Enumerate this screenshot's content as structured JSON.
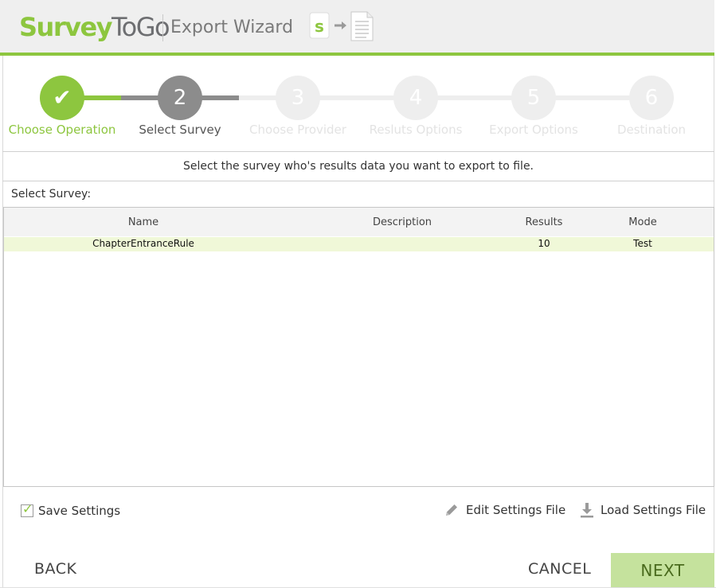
{
  "header": {
    "logo_part1": "Survey",
    "logo_part2": "ToGo",
    "title": "Export Wizard",
    "icon": "export-to-file-icon",
    "accent_color": "#8dc63f"
  },
  "steps": [
    {
      "number": "✔",
      "label": "Choose Operation",
      "state": "completed"
    },
    {
      "number": "2",
      "label": "Select Survey",
      "state": "current"
    },
    {
      "number": "3",
      "label": "Choose Provider",
      "state": "pending"
    },
    {
      "number": "4",
      "label": "Resluts Options",
      "state": "pending"
    },
    {
      "number": "5",
      "label": "Export Options",
      "state": "pending"
    },
    {
      "number": "6",
      "label": "Destination",
      "state": "pending"
    }
  ],
  "instruction": "Select the survey who's results data you want to export to file.",
  "select_label": "Select Survey:",
  "table": {
    "columns": [
      "Name",
      "Description",
      "Results",
      "Mode"
    ],
    "rows": [
      {
        "name": "ChapterEntranceRule",
        "description": "",
        "results": "10",
        "mode": "Test"
      }
    ]
  },
  "footer": {
    "save_settings_label": "Save Settings",
    "save_settings_checked": true,
    "edit_settings_label": "Edit Settings File",
    "load_settings_label": "Load Settings File",
    "back_label": "BACK",
    "cancel_label": "CANCEL",
    "next_label": "NEXT"
  }
}
